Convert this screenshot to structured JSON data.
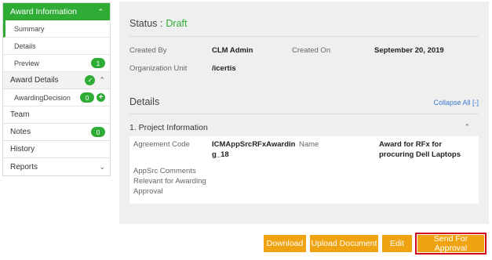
{
  "sidebar": {
    "award_information": "Award Information",
    "summary": "Summary",
    "details": "Details",
    "preview": "Preview",
    "preview_count": "1",
    "award_details": "Award Details",
    "awarding_decision": "AwardingDecision",
    "awarding_decision_count": "0",
    "team": "Team",
    "notes": "Notes",
    "notes_count": "0",
    "history": "History",
    "reports": "Reports"
  },
  "status": {
    "label": "Status :",
    "value": "Draft"
  },
  "meta": {
    "created_by_label": "Created By",
    "created_by_value": "CLM Admin",
    "created_on_label": "Created On",
    "created_on_value": "September 20, 2019",
    "org_unit_label": "Organization Unit",
    "org_unit_value": "/icertis"
  },
  "details": {
    "title": "Details",
    "collapse_label": "Collapse All [-]",
    "section_title": "1. Project Information",
    "agreement_code_label": "Agreement Code",
    "agreement_code_value_1": "ICMAppSrcRFxAwardin",
    "agreement_code_value_2": "g_18",
    "name_label": "Name",
    "name_value_1": "Award for RFx for",
    "name_value_2": "procuring Dell Laptops",
    "appsrc_label_1": "AppSrc Comments",
    "appsrc_label_2": "Relevant for Awarding",
    "appsrc_label_3": "Approval"
  },
  "actions": {
    "download": "Download",
    "upload_document": "Upload Document",
    "edit": "Edit",
    "send_for_approval": "Send For Approval"
  },
  "colors": {
    "accent_green": "#2eac35",
    "button_orange": "#f0a310",
    "highlight_red": "#d0021b",
    "link_blue": "#3a7bd5"
  }
}
